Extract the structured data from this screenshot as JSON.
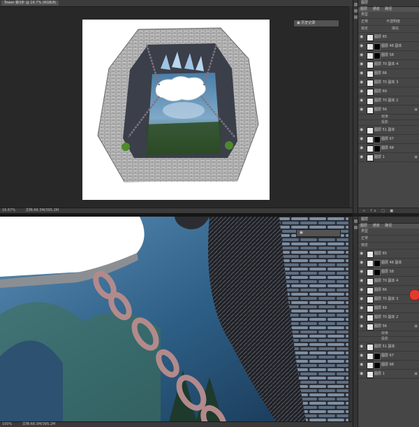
{
  "top_window": {
    "tab_title": "Tower·第3步 @ 16.7% (RGB/8)",
    "zoom": "16.67%",
    "doc_info": "文档:68.3M/395.2M",
    "float_label": "历史记录"
  },
  "bottom_window": {
    "zoom": "100%",
    "doc_info": "文档:68.3M/395.2M"
  },
  "layers_panel_top": {
    "title": "图层",
    "tabs": [
      "图层",
      "通道",
      "路径"
    ],
    "kind_label": "类型",
    "blend_mode": "正常",
    "opacity_label": "不透明度",
    "lock_label": "锁定",
    "fill_label": "填充",
    "layers": [
      {
        "name": "图层 65",
        "mask": false
      },
      {
        "name": "图层 48 副本",
        "mask": true
      },
      {
        "name": "图层 58",
        "mask": true
      },
      {
        "name": "图层 70 副本 4",
        "mask": false
      },
      {
        "name": "图层 66",
        "mask": false
      },
      {
        "name": "图层 70 副本 3",
        "mask": false
      },
      {
        "name": "图层 69",
        "mask": false
      },
      {
        "name": "图层 70 副本 2",
        "mask": false
      },
      {
        "name": "图层 56",
        "mask": false,
        "locked": true
      }
    ],
    "effects": [
      "效果",
      "投影"
    ],
    "layers_after": [
      {
        "name": "图层 51 副本",
        "mask": false
      },
      {
        "name": "图层 67",
        "mask": true
      },
      {
        "name": "图层 68",
        "mask": true
      },
      {
        "name": "图层 1",
        "mask": false,
        "locked": true
      }
    ],
    "footer_icons": "…"
  },
  "layers_panel_bottom": {
    "title": "图层",
    "layers": [
      {
        "name": "图层 65",
        "mask": false
      },
      {
        "name": "图层 48 副本",
        "mask": true
      },
      {
        "name": "图层 58",
        "mask": true
      },
      {
        "name": "图层 70 副本 4",
        "mask": false
      },
      {
        "name": "图层 66",
        "mask": false
      },
      {
        "name": "图层 70 副本 3",
        "mask": false
      },
      {
        "name": "图层 69",
        "mask": false
      },
      {
        "name": "图层 70 副本 2",
        "mask": false
      },
      {
        "name": "图层 56",
        "mask": false,
        "locked": true
      }
    ],
    "effects": [
      "效果",
      "投影"
    ],
    "layers_after": [
      {
        "name": "图层 51 副本",
        "mask": false
      },
      {
        "name": "图层 67",
        "mask": true
      },
      {
        "name": "图层 68",
        "mask": true
      },
      {
        "name": "图层 1",
        "mask": false,
        "locked": true
      }
    ]
  }
}
